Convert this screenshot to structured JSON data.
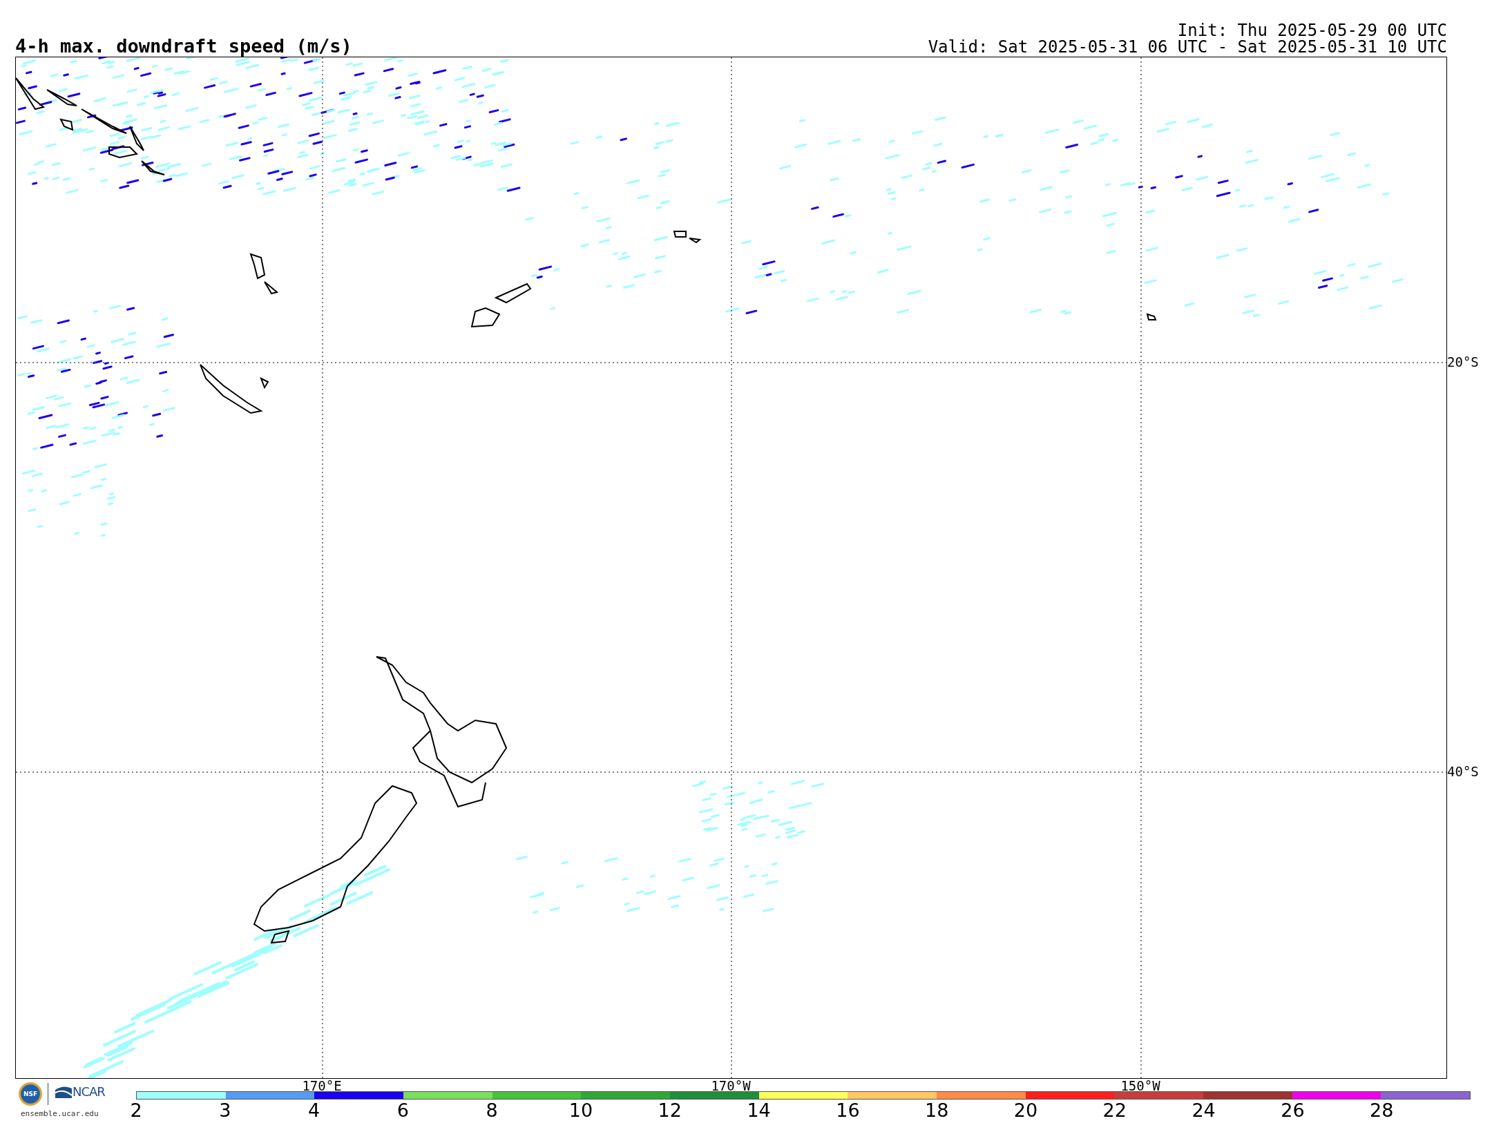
{
  "title": "4-h max. downdraft speed (m/s)",
  "init": "Init: Thu 2025-05-29 00 UTC",
  "valid": "Valid: Sat 2025-05-31 06 UTC - Sat 2025-05-31 10 UTC",
  "map": {
    "latitude_labels": [
      "20°S",
      "40°S"
    ],
    "longitude_labels": [
      "170°E",
      "170°W",
      "150°W"
    ]
  },
  "logos": {
    "nsf": "NSF",
    "ncar": "NCAR",
    "site": "ensemble.ucar.edu"
  },
  "colorbar": {
    "segments": [
      {
        "color": "#9ffefe"
      },
      {
        "color": "#559cf7"
      },
      {
        "color": "#1a00ee"
      },
      {
        "color": "#78e05a"
      },
      {
        "color": "#46c43c"
      },
      {
        "color": "#2ea836"
      },
      {
        "color": "#1e8f3a"
      },
      {
        "color": "#ffff5a"
      },
      {
        "color": "#ffc864"
      },
      {
        "color": "#ff8c46"
      },
      {
        "color": "#ff1e1e"
      },
      {
        "color": "#c83c3c"
      },
      {
        "color": "#a03232"
      },
      {
        "color": "#f000f0"
      },
      {
        "color": "#8c64d2"
      }
    ],
    "ticks": [
      "2",
      "3",
      "4",
      "6",
      "8",
      "10",
      "12",
      "14",
      "16",
      "18",
      "20",
      "22",
      "24",
      "26",
      "28"
    ]
  }
}
